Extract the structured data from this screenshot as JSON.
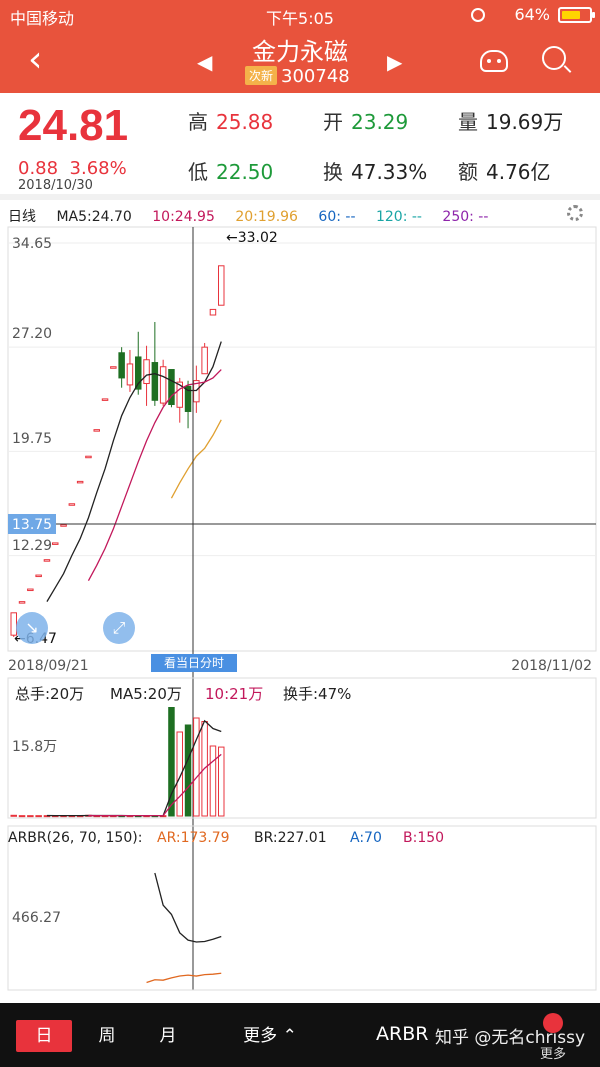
{
  "status_bar": {
    "carrier": "中国移动",
    "time": "下午5:05",
    "battery": "64%"
  },
  "nav": {
    "stock_name": "金力永磁",
    "badge": "次新",
    "code": "300748",
    "back_icon": "chevron-left-icon",
    "prev_icon": "triangle-left-icon",
    "next_icon": "triangle-right-icon"
  },
  "quote": {
    "price": "24.81",
    "change": "0.88",
    "change_pct": "3.68%",
    "date": "2018/10/30",
    "high_label": "高",
    "high": "25.88",
    "low_label": "低",
    "low": "22.50",
    "open_label": "开",
    "open": "23.29",
    "turnover_label": "换",
    "turnover": "47.33%",
    "volume_label": "量",
    "volume": "19.69万",
    "amount_label": "额",
    "amount": "4.76亿"
  },
  "ma_bar": {
    "label": "日线",
    "ma5": "MA5:24.70",
    "ma10": "10:24.95",
    "ma20": "20:19.96",
    "ma60": "60: --",
    "ma120": "120: --",
    "ma250": "250: --"
  },
  "colors": {
    "up": "#e8333c",
    "down": "#1e6f22",
    "ma5": "#222222",
    "ma10": "#c2185b",
    "ma20": "#e0a030",
    "ma60": "#1565c0",
    "ma120": "#1aa5a5",
    "ma250": "#8e24aa"
  },
  "kline": {
    "y_ticks": [
      "34.65",
      "27.20",
      "19.75",
      "12.29"
    ],
    "crosshair_price": "13.75",
    "max_label": "←33.02",
    "min_label": "←6.47",
    "start_date": "2018/09/21",
    "end_date": "2018/11/02",
    "today_btn": "看当日分时",
    "y_range": [
      6.47,
      34.65
    ]
  },
  "volume": {
    "total": "总手:20万",
    "ma5": "MA5:20万",
    "ma10": "10:21万",
    "turnover": "换手:47%",
    "y_tick": "15.8万"
  },
  "arbr": {
    "title": "ARBR(26, 70, 150):",
    "ar": "AR:173.79",
    "br": "BR:227.01",
    "a": "A:70",
    "b": "B:150",
    "y_tick": "466.27"
  },
  "bottom_bar": {
    "tab_day": "日",
    "tab_week": "周",
    "tab_month": "月",
    "more": "更多",
    "indicator": "ARBR",
    "watermark": "知乎 @无名chrissy",
    "more2": "更多"
  },
  "chart_data": {
    "type": "candlestick",
    "x_start": "2018/09/21",
    "x_end": "2018/11/02",
    "ylim": [
      6.47,
      34.65
    ],
    "candles": [
      {
        "o": 6.6,
        "c": 8.2,
        "h": 8.2,
        "l": 6.47
      },
      {
        "o": 9.0,
        "c": 9.0,
        "h": 9.0,
        "l": 9.0
      },
      {
        "o": 9.9,
        "c": 9.9,
        "h": 9.9,
        "l": 9.9
      },
      {
        "o": 10.9,
        "c": 10.9,
        "h": 10.9,
        "l": 10.9
      },
      {
        "o": 12.0,
        "c": 12.0,
        "h": 12.0,
        "l": 12.0
      },
      {
        "o": 13.2,
        "c": 13.2,
        "h": 13.2,
        "l": 13.2
      },
      {
        "o": 14.5,
        "c": 14.5,
        "h": 14.5,
        "l": 14.5
      },
      {
        "o": 16.0,
        "c": 16.0,
        "h": 16.0,
        "l": 16.0
      },
      {
        "o": 17.6,
        "c": 17.6,
        "h": 17.6,
        "l": 17.6
      },
      {
        "o": 19.4,
        "c": 19.4,
        "h": 19.4,
        "l": 19.4
      },
      {
        "o": 21.3,
        "c": 21.3,
        "h": 21.3,
        "l": 21.3
      },
      {
        "o": 23.5,
        "c": 23.5,
        "h": 23.5,
        "l": 23.5
      },
      {
        "o": 25.8,
        "c": 25.8,
        "h": 25.8,
        "l": 25.8
      },
      {
        "o": 26.8,
        "c": 25.0,
        "h": 27.2,
        "l": 24.3
      },
      {
        "o": 24.5,
        "c": 26.0,
        "h": 27.0,
        "l": 24.0
      },
      {
        "o": 26.5,
        "c": 24.2,
        "h": 28.3,
        "l": 23.8
      },
      {
        "o": 24.6,
        "c": 26.3,
        "h": 27.3,
        "l": 23.0
      },
      {
        "o": 26.1,
        "c": 23.4,
        "h": 29.0,
        "l": 23.0
      },
      {
        "o": 23.2,
        "c": 25.8,
        "h": 26.3,
        "l": 23.0
      },
      {
        "o": 25.6,
        "c": 23.1,
        "h": 25.6,
        "l": 22.9
      },
      {
        "o": 22.9,
        "c": 24.7,
        "h": 25.0,
        "l": 21.8
      },
      {
        "o": 24.4,
        "c": 22.6,
        "h": 24.8,
        "l": 21.4
      },
      {
        "o": 23.29,
        "c": 24.81,
        "h": 25.88,
        "l": 22.5
      },
      {
        "o": 25.3,
        "c": 27.2,
        "h": 27.5,
        "l": 25.3
      },
      {
        "o": 29.5,
        "c": 29.9,
        "h": 29.9,
        "l": 29.5
      },
      {
        "o": 30.2,
        "c": 33.02,
        "h": 33.02,
        "l": 30.2
      }
    ],
    "ma5": [
      null,
      null,
      null,
      null,
      9.0,
      10.0,
      11.0,
      12.3,
      13.5,
      15.0,
      16.8,
      18.5,
      20.5,
      22.3,
      23.6,
      24.6,
      25.2,
      25.3,
      25.1,
      24.8,
      24.5,
      24.1,
      24.1,
      24.7,
      25.8,
      27.6
    ],
    "ma10": [
      null,
      null,
      null,
      null,
      null,
      null,
      null,
      null,
      null,
      10.5,
      11.6,
      12.8,
      14.2,
      15.8,
      17.4,
      19.0,
      20.5,
      21.8,
      22.9,
      23.7,
      24.2,
      24.5,
      24.6,
      24.7,
      25.0,
      25.6
    ],
    "ma20": [
      null,
      null,
      null,
      null,
      null,
      null,
      null,
      null,
      null,
      null,
      null,
      null,
      null,
      null,
      null,
      null,
      null,
      null,
      null,
      16.4,
      17.5,
      18.5,
      19.4,
      19.96,
      20.9,
      22.0
    ],
    "volume": [
      0.2,
      0.1,
      0.1,
      0.1,
      0.1,
      0.1,
      0.1,
      0.1,
      0.1,
      0.2,
      0.1,
      0.1,
      0.1,
      0.1,
      0.1,
      0.1,
      0.1,
      0.1,
      0.1,
      31,
      24,
      26,
      28,
      27,
      20,
      19.69
    ],
    "volume_ylim": [
      0,
      32
    ],
    "ar": [
      null,
      null,
      null,
      null,
      null,
      null,
      null,
      null,
      null,
      null,
      null,
      null,
      null,
      null,
      null,
      null,
      null,
      1250,
      900,
      800,
      600,
      520,
      500,
      505,
      530,
      560
    ],
    "br": [
      null,
      null,
      null,
      null,
      null,
      null,
      null,
      null,
      null,
      null,
      null,
      null,
      null,
      null,
      null,
      null,
      60,
      90,
      85,
      110,
      130,
      140,
      130,
      145,
      150,
      160
    ],
    "arbr_ylim": [
      0,
      1500
    ]
  }
}
